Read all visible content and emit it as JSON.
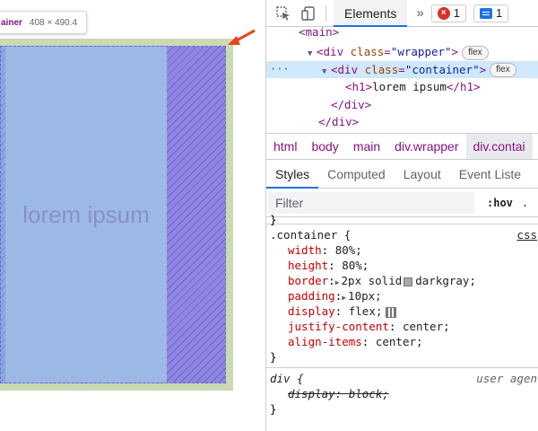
{
  "preview": {
    "tooltip": {
      "name": "ainer",
      "size": "408 × 490.4"
    },
    "h1_text": "lorem ipsum"
  },
  "toolbar": {
    "tab_elements": "Elements",
    "more_tabs": "»",
    "error_count": "1",
    "message_count": "1"
  },
  "dom_tree": {
    "line1": {
      "tag_open": "<main>"
    },
    "line2": {
      "tag": "<div ",
      "attr": "class",
      "eq": "=",
      "val": "\"wrapper\"",
      "close": ">",
      "badge": "flex"
    },
    "line3": {
      "ellipsis": "···",
      "tag": "<div ",
      "attr": "class",
      "eq": "=",
      "val": "\"container\"",
      "close": ">",
      "badge": "flex"
    },
    "line4": {
      "open": "<h1>",
      "text": "lorem ipsum",
      "close": "</h1>"
    },
    "line5": {
      "tag": "</div>"
    },
    "line6": {
      "tag": "</div>"
    }
  },
  "breadcrumb": {
    "items": [
      "html",
      "body",
      "main",
      "div.wrapper",
      "div.contai"
    ]
  },
  "styles_tabs": [
    "Styles",
    "Computed",
    "Layout",
    "Event Liste"
  ],
  "filter": {
    "placeholder": "Filter",
    "hov": ":hov",
    "cls": "."
  },
  "rules": {
    "top_brace": "}",
    "container": {
      "selector": ".container {",
      "source": "css",
      "props": [
        {
          "name": "width",
          "value": "80%;"
        },
        {
          "name": "height",
          "value": "80%;"
        },
        {
          "name": "border",
          "value_pre": "2px solid",
          "value_post": "darkgray;"
        },
        {
          "name": "padding",
          "value": "10px;"
        },
        {
          "name": "display",
          "value": "flex;"
        },
        {
          "name": "justify-content",
          "value": "center;"
        },
        {
          "name": "align-items",
          "value": "center;"
        }
      ],
      "close": "}"
    },
    "div_ua": {
      "selector": "div {",
      "source": "user agen",
      "prop": {
        "name": "display",
        "value": "block;"
      },
      "close": "}"
    }
  },
  "colors": {
    "selected_row": "#cfe8fc",
    "tag": "#881280",
    "prop_name": "#c80000",
    "accent": "#1a73e8",
    "error": "#d93025",
    "arrow": "#e8451e"
  }
}
